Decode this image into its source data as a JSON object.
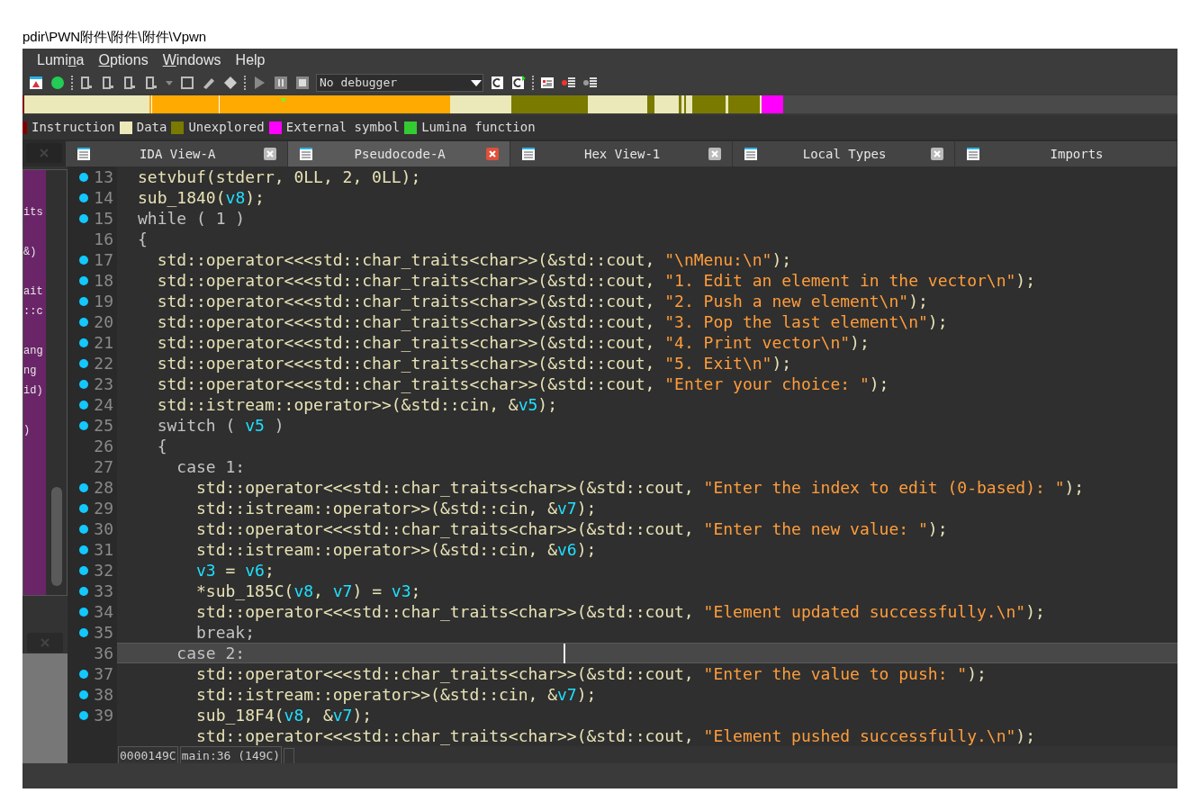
{
  "window": {
    "title": "pdir\\PWN附件\\附件\\附件\\Vpwn"
  },
  "menu": [
    {
      "parts": [
        {
          "text": "Lumi",
          "underlined": false
        },
        {
          "text": "n",
          "underlined": true
        },
        {
          "text": "a",
          "underlined": false
        }
      ]
    },
    {
      "parts": [
        {
          "text": "O",
          "underlined": true
        },
        {
          "text": "ptions",
          "underlined": false
        }
      ]
    },
    {
      "parts": [
        {
          "text": "W",
          "underlined": true
        },
        {
          "text": "indows",
          "underlined": false
        }
      ]
    },
    {
      "parts": [
        {
          "text": "Help",
          "underlined": false
        }
      ]
    }
  ],
  "toolbar": {
    "debugger_select": {
      "value": "No debugger"
    }
  },
  "legend": [
    {
      "label": "Instruction",
      "color": "#800000"
    },
    {
      "label": "Data",
      "color": "#ebe8b9"
    },
    {
      "label": "Unexplored",
      "color": "#7a7a00"
    },
    {
      "label": "External symbol",
      "color": "#ff00ff"
    },
    {
      "label": "Lumina function",
      "color": "#33cc33"
    }
  ],
  "tabs": [
    {
      "label": "IDA View-A",
      "selected": false,
      "closable": true
    },
    {
      "label": "Pseudocode-A",
      "selected": true,
      "closable": true
    },
    {
      "label": "Hex View-1",
      "selected": false,
      "closable": true
    },
    {
      "label": "Local Types",
      "selected": false,
      "closable": true
    },
    {
      "label": "Imports",
      "selected": false,
      "closable": false
    }
  ],
  "left_panel": {
    "blocks": [
      [
        "its"
      ],
      [
        "&)"
      ],
      [
        "ait",
        "::c"
      ],
      [
        "ang",
        "ng",
        "id)"
      ],
      [
        ")"
      ]
    ]
  },
  "code": {
    "lines": [
      {
        "number": "13",
        "dot": true,
        "current": false,
        "tokens": [
          {
            "kind": "plain",
            "text": "setvbuf(stderr, 0LL, 2, 0LL);"
          }
        ]
      },
      {
        "number": "14",
        "dot": true,
        "current": false,
        "tokens": [
          {
            "kind": "plain",
            "text": "sub_1840("
          },
          {
            "kind": "var",
            "text": "v8"
          },
          {
            "kind": "plain",
            "text": ");"
          }
        ]
      },
      {
        "number": "15",
        "dot": true,
        "current": false,
        "tokens": [
          {
            "kind": "keyword",
            "text": "while ( 1 )"
          }
        ]
      },
      {
        "number": "16",
        "dot": false,
        "current": false,
        "tokens": [
          {
            "kind": "keyword",
            "text": "{"
          }
        ]
      },
      {
        "number": "17",
        "dot": true,
        "current": false,
        "tokens": [
          {
            "kind": "plain",
            "text": "  std::operator<<<std::char_traits<char>>(&std::cout, "
          },
          {
            "kind": "string",
            "text": "\"\\nMenu:\\n\""
          },
          {
            "kind": "plain",
            "text": ");"
          }
        ]
      },
      {
        "number": "18",
        "dot": true,
        "current": false,
        "tokens": [
          {
            "kind": "plain",
            "text": "  std::operator<<<std::char_traits<char>>(&std::cout, "
          },
          {
            "kind": "string",
            "text": "\"1. Edit an element in the vector\\n\""
          },
          {
            "kind": "plain",
            "text": ");"
          }
        ]
      },
      {
        "number": "19",
        "dot": true,
        "current": false,
        "tokens": [
          {
            "kind": "plain",
            "text": "  std::operator<<<std::char_traits<char>>(&std::cout, "
          },
          {
            "kind": "string",
            "text": "\"2. Push a new element\\n\""
          },
          {
            "kind": "plain",
            "text": ");"
          }
        ]
      },
      {
        "number": "20",
        "dot": true,
        "current": false,
        "tokens": [
          {
            "kind": "plain",
            "text": "  std::operator<<<std::char_traits<char>>(&std::cout, "
          },
          {
            "kind": "string",
            "text": "\"3. Pop the last element\\n\""
          },
          {
            "kind": "plain",
            "text": ");"
          }
        ]
      },
      {
        "number": "21",
        "dot": true,
        "current": false,
        "tokens": [
          {
            "kind": "plain",
            "text": "  std::operator<<<std::char_traits<char>>(&std::cout, "
          },
          {
            "kind": "string",
            "text": "\"4. Print vector\\n\""
          },
          {
            "kind": "plain",
            "text": ");"
          }
        ]
      },
      {
        "number": "22",
        "dot": true,
        "current": false,
        "tokens": [
          {
            "kind": "plain",
            "text": "  std::operator<<<std::char_traits<char>>(&std::cout, "
          },
          {
            "kind": "string",
            "text": "\"5. Exit\\n\""
          },
          {
            "kind": "plain",
            "text": ");"
          }
        ]
      },
      {
        "number": "23",
        "dot": true,
        "current": false,
        "tokens": [
          {
            "kind": "plain",
            "text": "  std::operator<<<std::char_traits<char>>(&std::cout, "
          },
          {
            "kind": "string",
            "text": "\"Enter your choice: \""
          },
          {
            "kind": "plain",
            "text": ");"
          }
        ]
      },
      {
        "number": "24",
        "dot": true,
        "current": false,
        "tokens": [
          {
            "kind": "plain",
            "text": "  std::istream::operator>>(&std::cin, &"
          },
          {
            "kind": "var",
            "text": "v5"
          },
          {
            "kind": "plain",
            "text": ");"
          }
        ]
      },
      {
        "number": "25",
        "dot": true,
        "current": false,
        "tokens": [
          {
            "kind": "keyword",
            "text": "  switch ( "
          },
          {
            "kind": "var",
            "text": "v5"
          },
          {
            "kind": "keyword",
            "text": " )"
          }
        ]
      },
      {
        "number": "26",
        "dot": false,
        "current": false,
        "tokens": [
          {
            "kind": "keyword",
            "text": "  {"
          }
        ]
      },
      {
        "number": "27",
        "dot": false,
        "current": false,
        "tokens": [
          {
            "kind": "keyword",
            "text": "    case 1:"
          }
        ]
      },
      {
        "number": "28",
        "dot": true,
        "current": false,
        "tokens": [
          {
            "kind": "plain",
            "text": "      std::operator<<<std::char_traits<char>>(&std::cout, "
          },
          {
            "kind": "string",
            "text": "\"Enter the index to edit (0-based): \""
          },
          {
            "kind": "plain",
            "text": ");"
          }
        ]
      },
      {
        "number": "29",
        "dot": true,
        "current": false,
        "tokens": [
          {
            "kind": "plain",
            "text": "      std::istream::operator>>(&std::cin, &"
          },
          {
            "kind": "var",
            "text": "v7"
          },
          {
            "kind": "plain",
            "text": ");"
          }
        ]
      },
      {
        "number": "30",
        "dot": true,
        "current": false,
        "tokens": [
          {
            "kind": "plain",
            "text": "      std::operator<<<std::char_traits<char>>(&std::cout, "
          },
          {
            "kind": "string",
            "text": "\"Enter the new value: \""
          },
          {
            "kind": "plain",
            "text": ");"
          }
        ]
      },
      {
        "number": "31",
        "dot": true,
        "current": false,
        "tokens": [
          {
            "kind": "plain",
            "text": "      std::istream::operator>>(&std::cin, &"
          },
          {
            "kind": "var",
            "text": "v6"
          },
          {
            "kind": "plain",
            "text": ");"
          }
        ]
      },
      {
        "number": "32",
        "dot": true,
        "current": false,
        "tokens": [
          {
            "kind": "var",
            "text": "      v3"
          },
          {
            "kind": "plain",
            "text": " = "
          },
          {
            "kind": "var",
            "text": "v6"
          },
          {
            "kind": "plain",
            "text": ";"
          }
        ]
      },
      {
        "number": "33",
        "dot": true,
        "current": false,
        "tokens": [
          {
            "kind": "plain",
            "text": "      *sub_185C("
          },
          {
            "kind": "var",
            "text": "v8"
          },
          {
            "kind": "plain",
            "text": ", "
          },
          {
            "kind": "var",
            "text": "v7"
          },
          {
            "kind": "plain",
            "text": ") = "
          },
          {
            "kind": "var",
            "text": "v3"
          },
          {
            "kind": "plain",
            "text": ";"
          }
        ]
      },
      {
        "number": "34",
        "dot": true,
        "current": false,
        "tokens": [
          {
            "kind": "plain",
            "text": "      std::operator<<<std::char_traits<char>>(&std::cout, "
          },
          {
            "kind": "string",
            "text": "\"Element updated successfully.\\n\""
          },
          {
            "kind": "plain",
            "text": ");"
          }
        ]
      },
      {
        "number": "35",
        "dot": true,
        "current": false,
        "tokens": [
          {
            "kind": "keyword",
            "text": "      break;"
          }
        ]
      },
      {
        "number": "36",
        "dot": false,
        "current": true,
        "tokens": [
          {
            "kind": "keyword",
            "text": "    case 2:"
          }
        ]
      },
      {
        "number": "37",
        "dot": true,
        "current": false,
        "tokens": [
          {
            "kind": "plain",
            "text": "      std::operator<<<std::char_traits<char>>(&std::cout, "
          },
          {
            "kind": "string",
            "text": "\"Enter the value to push: \""
          },
          {
            "kind": "plain",
            "text": ");"
          }
        ]
      },
      {
        "number": "38",
        "dot": true,
        "current": false,
        "tokens": [
          {
            "kind": "plain",
            "text": "      std::istream::operator>>(&std::cin, &"
          },
          {
            "kind": "var",
            "text": "v7"
          },
          {
            "kind": "plain",
            "text": ");"
          }
        ]
      },
      {
        "number": "39",
        "dot": true,
        "current": false,
        "tokens": [
          {
            "kind": "plain",
            "text": "      sub_18F4("
          },
          {
            "kind": "var",
            "text": "v8"
          },
          {
            "kind": "plain",
            "text": ", &"
          },
          {
            "kind": "var",
            "text": "v7"
          },
          {
            "kind": "plain",
            "text": ");"
          }
        ]
      },
      {
        "dot": false,
        "current": false,
        "tokens": [
          {
            "kind": "plain",
            "text": "      std::operator<<<std::char_traits<char>>(&std::cout, "
          },
          {
            "kind": "string",
            "text": "\"Element pushed successfully.\\n\""
          },
          {
            "kind": "plain",
            "text": ");"
          }
        ]
      }
    ]
  },
  "status_bar": {
    "address": "0000149C",
    "location": "main:36 (149C)"
  }
}
